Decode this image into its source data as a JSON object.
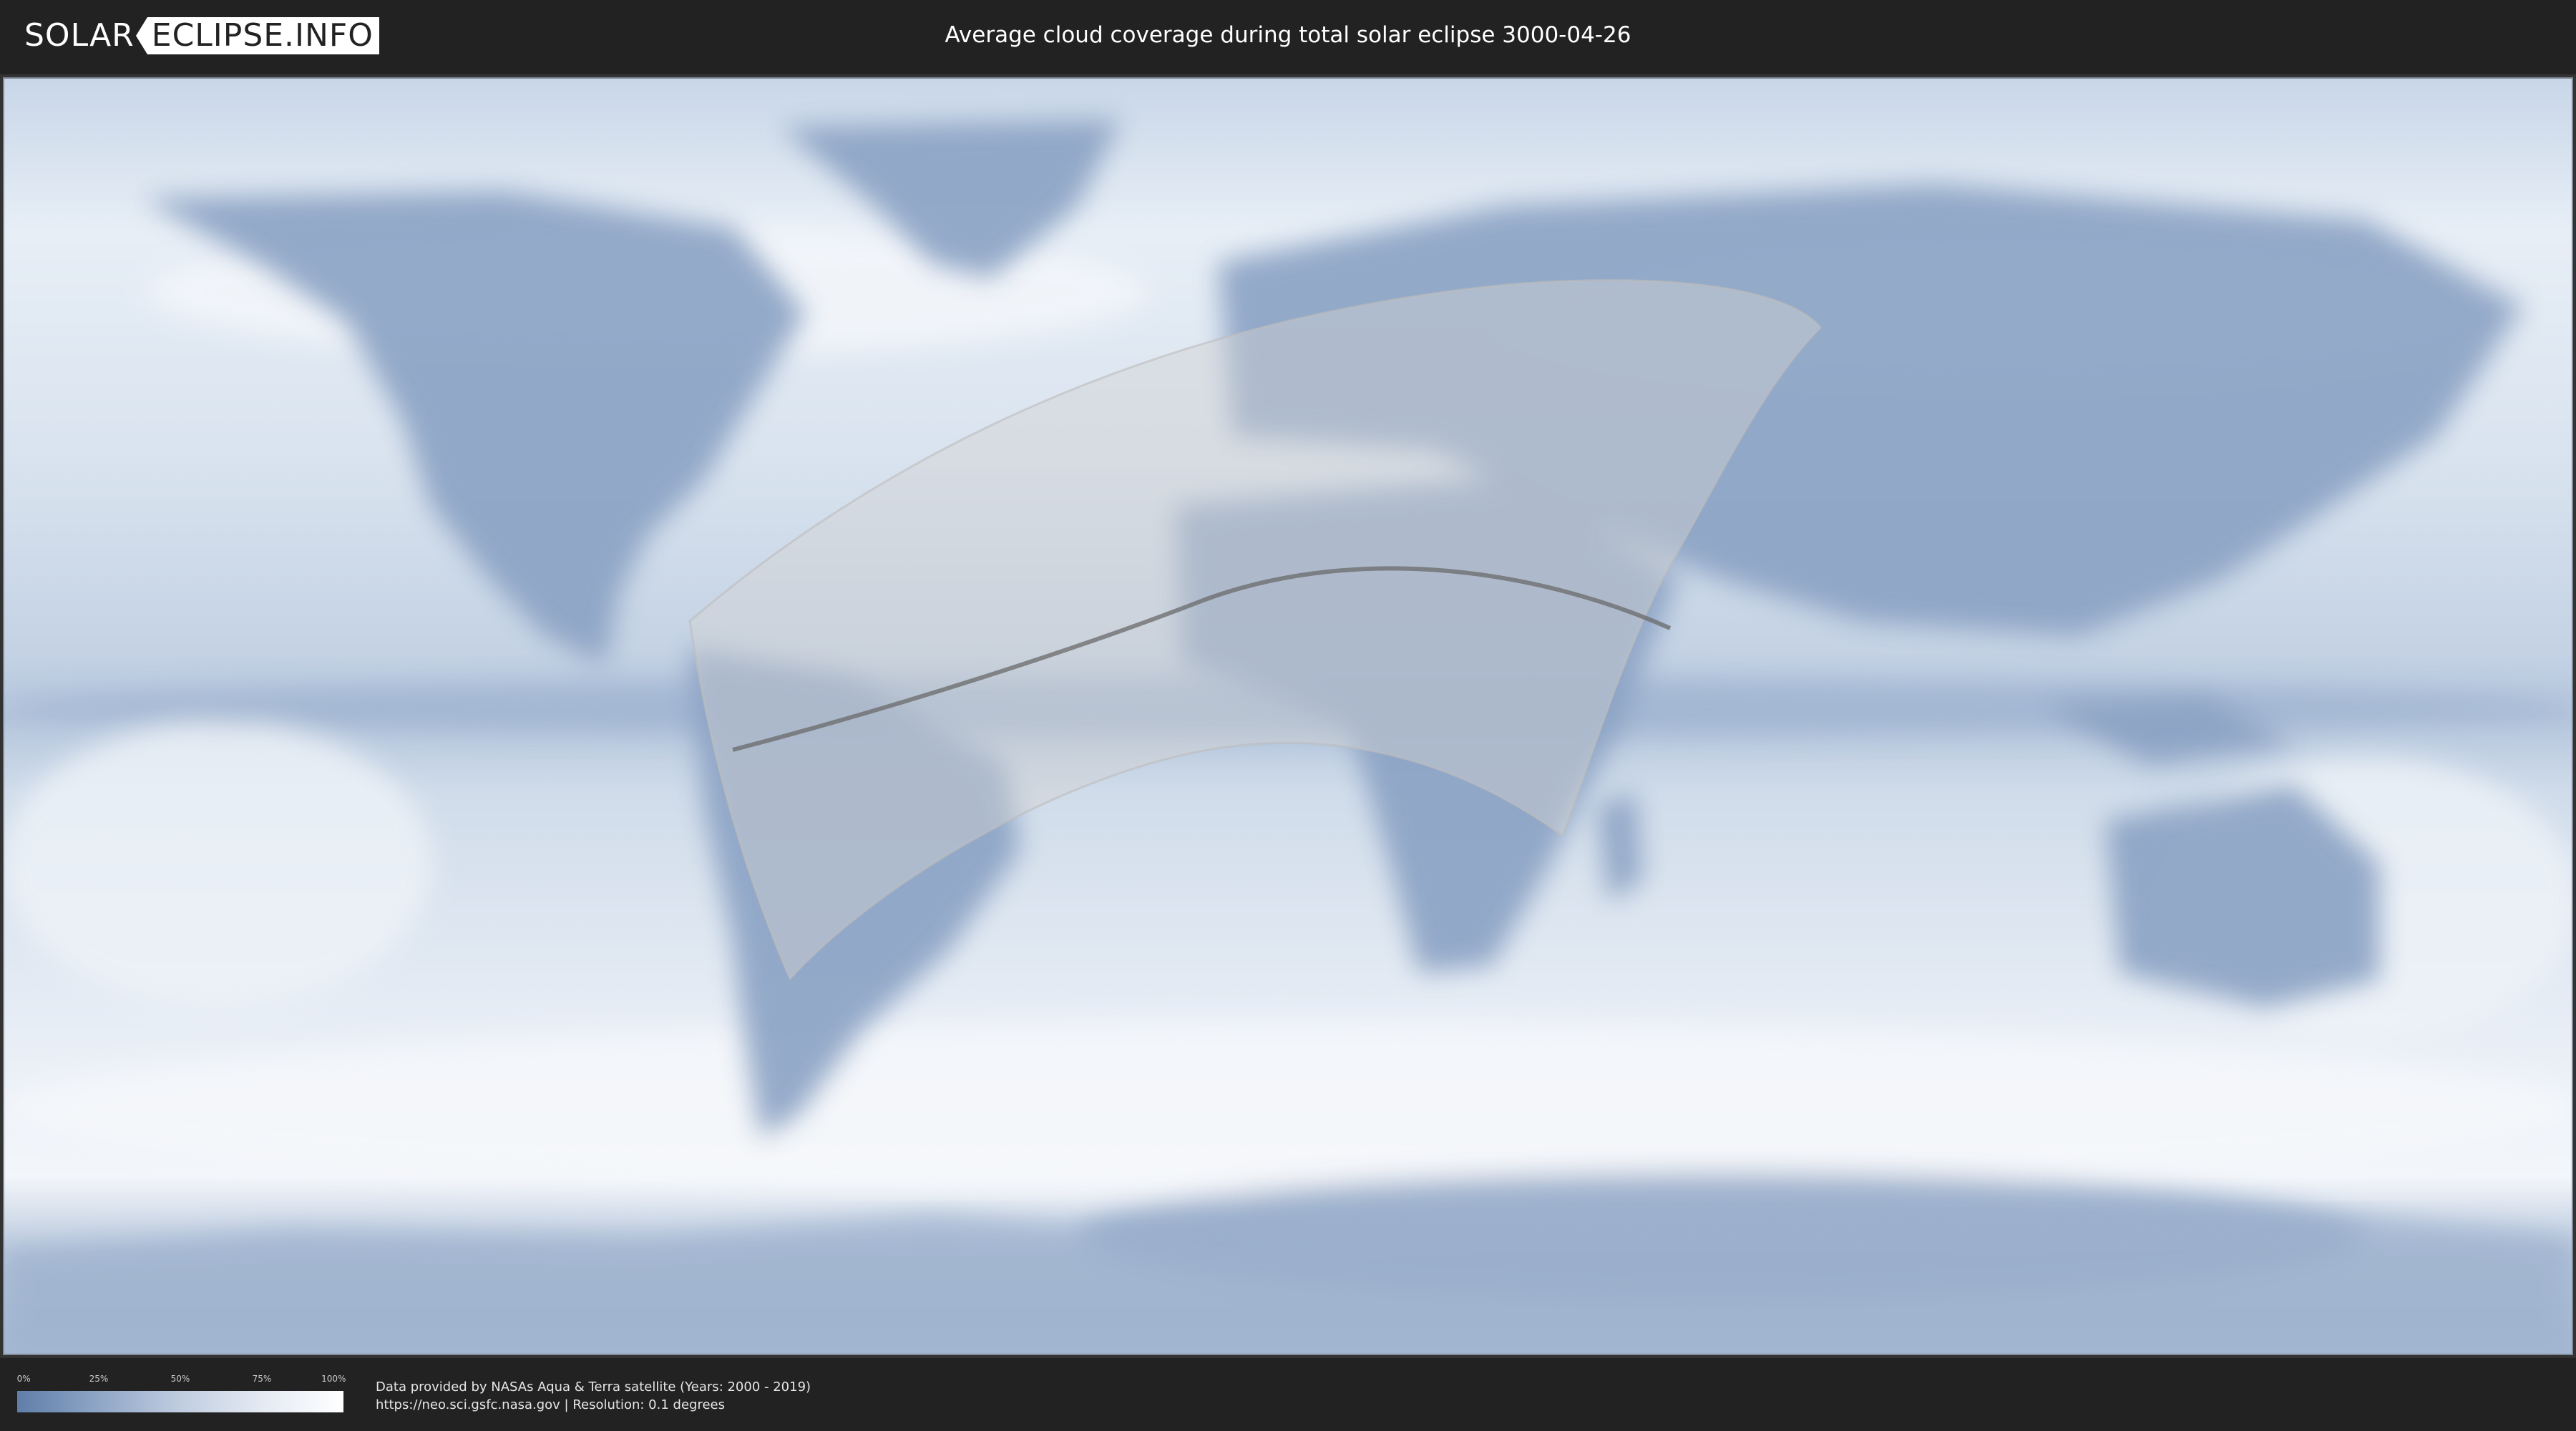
{
  "header": {
    "logo_left": "SOLAR",
    "logo_right": "ECLIPSE.INFO",
    "title": "Average cloud coverage during total solar eclipse 3000-04-26"
  },
  "legend": {
    "ticks": [
      "0%",
      "25%",
      "50%",
      "75%",
      "100%"
    ],
    "colors": [
      "#5f7ea8",
      "#8fa6c6",
      "#c0cde0",
      "#e4eaf3",
      "#ffffff"
    ]
  },
  "credits": {
    "line1": "Data provided by NASAs Aqua & Terra satellite (Years: 2000 - 2019)",
    "line2": "https://neo.sci.gsfc.nasa.gov | Resolution: 0.1 degrees"
  },
  "colors": {
    "background": "#222222",
    "ocean_cloud": "#dde6f1",
    "land": "#7f98bd",
    "eclipse_overlay": "#d4d4d4",
    "eclipse_path": "#6a6a6a"
  }
}
